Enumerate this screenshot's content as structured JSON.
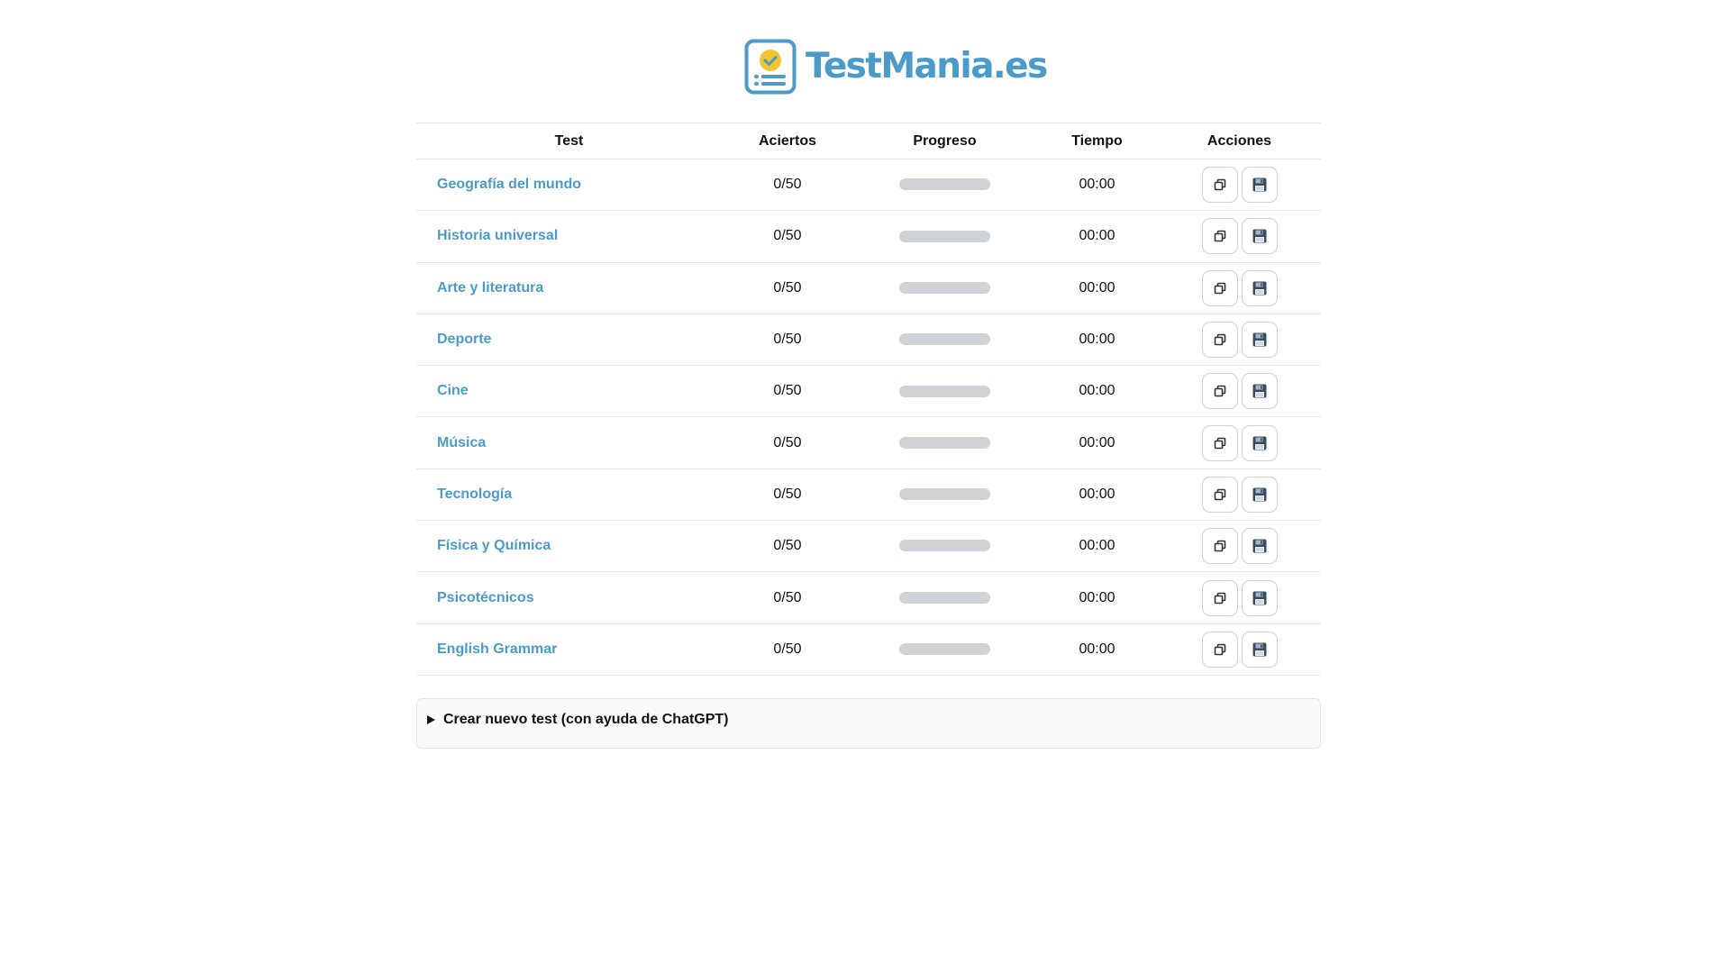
{
  "brand": {
    "name": "TestMania.es",
    "color": "#4a9bc9",
    "accent": "#f2c52e"
  },
  "table": {
    "headers": [
      "Test",
      "Aciertos",
      "Progreso",
      "Tiempo",
      "Acciones"
    ],
    "rows": [
      {
        "name": "Geografía del mundo",
        "score": "0/50",
        "progress": 0,
        "time": "00:00"
      },
      {
        "name": "Historia universal",
        "score": "0/50",
        "progress": 0,
        "time": "00:00"
      },
      {
        "name": "Arte y literatura",
        "score": "0/50",
        "progress": 0,
        "time": "00:00"
      },
      {
        "name": "Deporte",
        "score": "0/50",
        "progress": 0,
        "time": "00:00"
      },
      {
        "name": "Cine",
        "score": "0/50",
        "progress": 0,
        "time": "00:00"
      },
      {
        "name": "Música",
        "score": "0/50",
        "progress": 0,
        "time": "00:00"
      },
      {
        "name": "Tecnología",
        "score": "0/50",
        "progress": 0,
        "time": "00:00"
      },
      {
        "name": "Física y Química",
        "score": "0/50",
        "progress": 0,
        "time": "00:00"
      },
      {
        "name": "Psicotécnicos",
        "score": "0/50",
        "progress": 0,
        "time": "00:00"
      },
      {
        "name": "English Grammar",
        "score": "0/50",
        "progress": 0,
        "time": "00:00"
      }
    ],
    "actions": [
      {
        "name": "copy-button",
        "icon": "copy-icon"
      },
      {
        "name": "save-button",
        "icon": "floppy-disk-icon"
      }
    ]
  },
  "create_test": {
    "summary": "Crear nuevo test (con ayuda de ChatGPT)",
    "expanded": false
  }
}
